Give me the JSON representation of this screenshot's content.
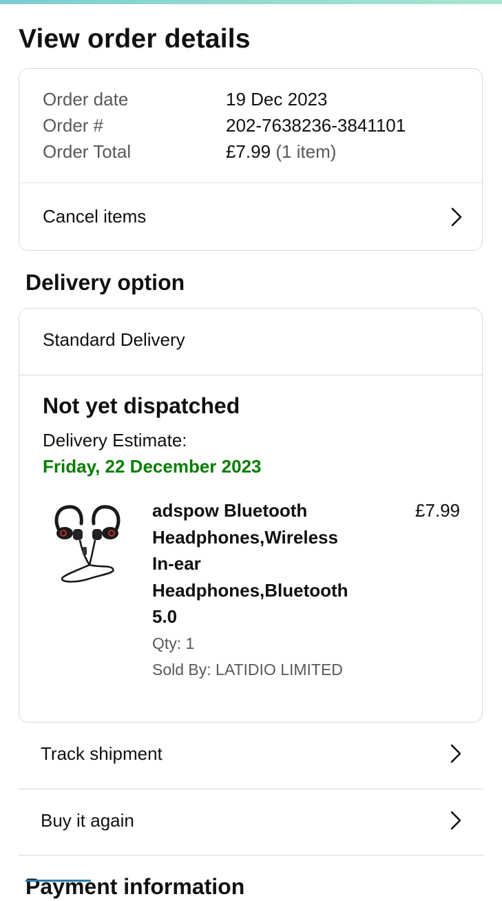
{
  "page": {
    "title": "View order details"
  },
  "order_summary": {
    "rows": [
      {
        "label": "Order date",
        "value": "19 Dec 2023"
      },
      {
        "label": "Order #",
        "value": "202-7638236-3841101"
      },
      {
        "label": "Order Total",
        "value": "£7.99",
        "suffix": "(1 item)"
      }
    ],
    "cancel_label": "Cancel items"
  },
  "delivery": {
    "heading": "Delivery option",
    "type": "Standard Delivery",
    "status": "Not yet dispatched",
    "estimate_label": "Delivery Estimate:",
    "estimate_date": "Friday, 22 December 2023",
    "estimate_color": "#067d00",
    "item": {
      "title_lines": [
        "adspow Bluetooth",
        "Headphones,Wireless",
        "In-ear",
        "Headphones,Bluetooth",
        "5.0"
      ],
      "price": "£7.99",
      "qty": "Qty: 1",
      "sold_by": "Sold By: LATIDIO LIMITED",
      "image_icon": "earphones-product-image"
    }
  },
  "actions": {
    "track_label": "Track shipment",
    "buy_again_label": "Buy it again"
  },
  "next_section": {
    "heading_partial": "Payment information"
  },
  "colors": {
    "text": "#0f1111",
    "muted": "#565959",
    "border": "#d5d9d9",
    "accent_green": "#067d00"
  }
}
